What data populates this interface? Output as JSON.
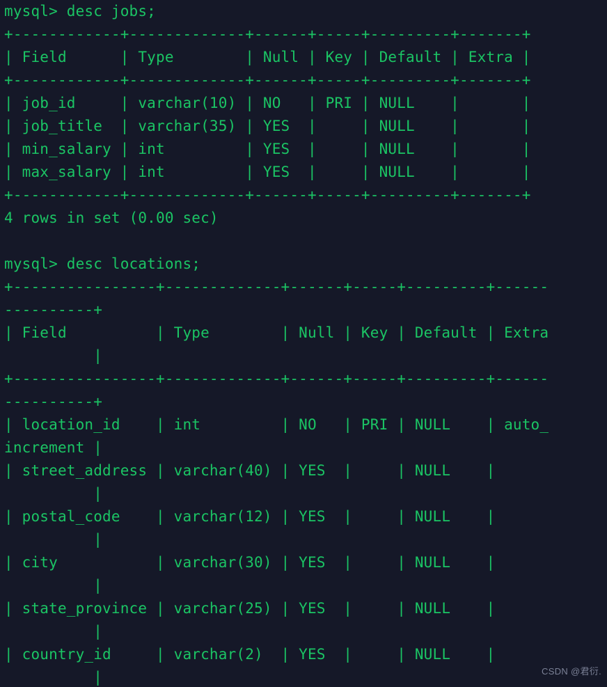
{
  "terminal": {
    "prompt": "mysql> ",
    "background_color": "#151828",
    "text_color": "#1bc464",
    "watermark": "CSDN @君衍."
  },
  "session": {
    "blocks": [
      {
        "command": "mysql> desc jobs;",
        "result_status": "4 rows in set (0.00 sec)",
        "table": {
          "columns": [
            "Field",
            "Type",
            "Null",
            "Key",
            "Default",
            "Extra"
          ],
          "rows": [
            [
              "job_id",
              "varchar(10)",
              "NO",
              "PRI",
              "NULL",
              ""
            ],
            [
              "job_title",
              "varchar(35)",
              "YES",
              "",
              "NULL",
              ""
            ],
            [
              "min_salary",
              "int",
              "YES",
              "",
              "NULL",
              ""
            ],
            [
              "max_salary",
              "int",
              "YES",
              "",
              "NULL",
              ""
            ]
          ]
        }
      },
      {
        "command": "mysql> desc locations;",
        "result_status": "",
        "table": {
          "columns": [
            "Field",
            "Type",
            "Null",
            "Key",
            "Default",
            "Extra"
          ],
          "rows": [
            [
              "location_id",
              "int",
              "NO",
              "PRI",
              "NULL",
              "auto_increment"
            ],
            [
              "street_address",
              "varchar(40)",
              "YES",
              "",
              "NULL",
              ""
            ],
            [
              "postal_code",
              "varchar(12)",
              "YES",
              "",
              "NULL",
              ""
            ],
            [
              "city",
              "varchar(30)",
              "YES",
              "",
              "NULL",
              ""
            ],
            [
              "state_province",
              "varchar(25)",
              "YES",
              "",
              "NULL",
              ""
            ],
            [
              "country_id",
              "varchar(2)",
              "YES",
              "",
              "NULL",
              ""
            ]
          ]
        }
      }
    ]
  },
  "rendered_lines": [
    "mysql> desc jobs;",
    "+------------+-------------+------+-----+---------+-------+",
    "| Field      | Type        | Null | Key | Default | Extra |",
    "+------------+-------------+------+-----+---------+-------+",
    "| job_id     | varchar(10) | NO   | PRI | NULL    |       |",
    "| job_title  | varchar(35) | YES  |     | NULL    |       |",
    "| min_salary | int         | YES  |     | NULL    |       |",
    "| max_salary | int         | YES  |     | NULL    |       |",
    "+------------+-------------+------+-----+---------+-------+",
    "4 rows in set (0.00 sec)",
    "",
    "mysql> desc locations;",
    "+----------------+-------------+------+-----+---------+------",
    "----------+",
    "| Field          | Type        | Null | Key | Default | Extra",
    "          |",
    "+----------------+-------------+------+-----+---------+------",
    "----------+",
    "| location_id    | int         | NO   | PRI | NULL    | auto_",
    "increment |",
    "| street_address | varchar(40) | YES  |     | NULL    |      ",
    "          |",
    "| postal_code    | varchar(12) | YES  |     | NULL    |      ",
    "          |",
    "| city           | varchar(30) | YES  |     | NULL    |      ",
    "          |",
    "| state_province | varchar(25) | YES  |     | NULL    |      ",
    "          |",
    "| country_id     | varchar(2)  | YES  |     | NULL    |      ",
    "          |"
  ]
}
